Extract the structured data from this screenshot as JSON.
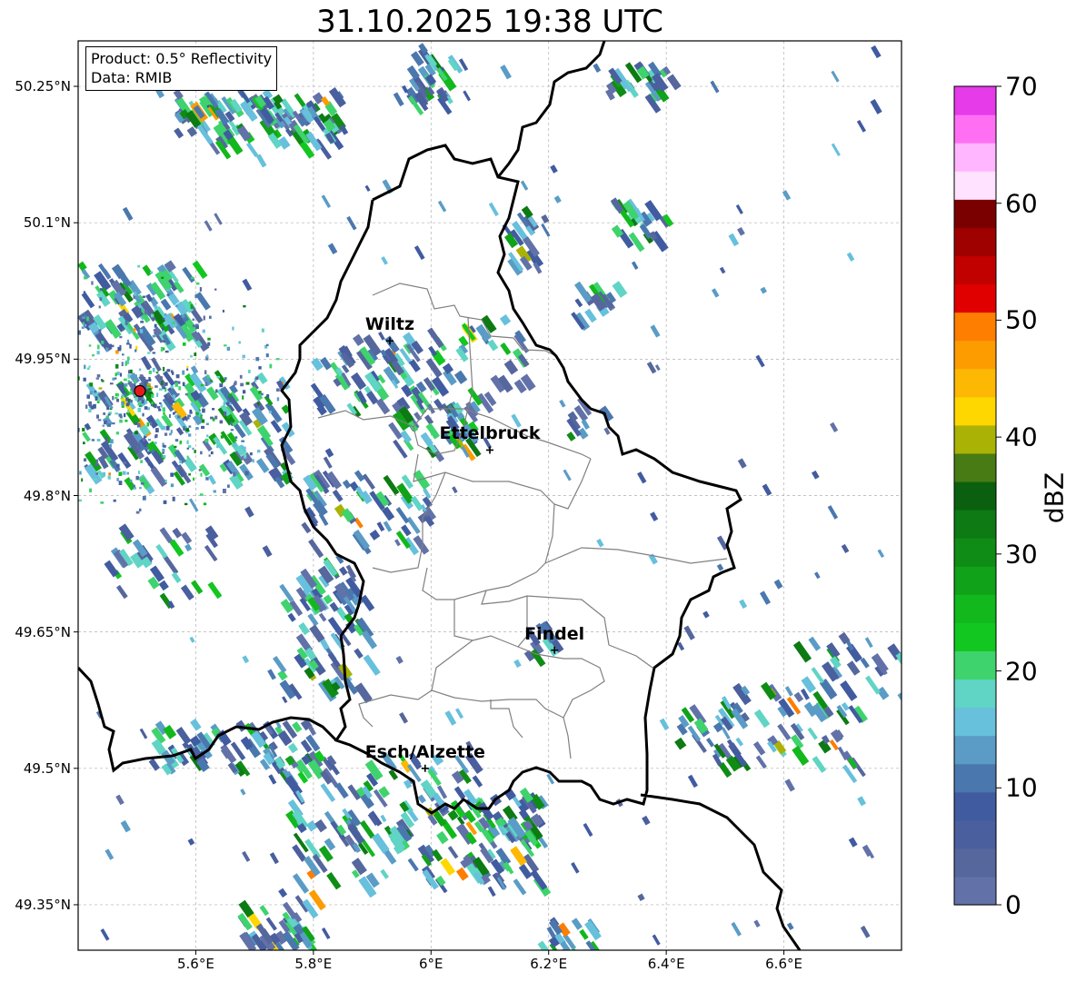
{
  "title": "31.10.2025 19:38 UTC",
  "info": {
    "product": "Product: 0.5° Reflectivity",
    "data_source": "Data: RMIB"
  },
  "map": {
    "extent": {
      "lon": [
        5.4,
        6.8
      ],
      "lat": [
        49.3,
        50.3
      ]
    },
    "lat_ticks": [
      {
        "value": 50.25,
        "label": "50.25°N"
      },
      {
        "value": 50.1,
        "label": "50.1°N"
      },
      {
        "value": 49.95,
        "label": "49.95°N"
      },
      {
        "value": 49.8,
        "label": "49.8°N"
      },
      {
        "value": 49.65,
        "label": "49.65°N"
      },
      {
        "value": 49.5,
        "label": "49.5°N"
      },
      {
        "value": 49.35,
        "label": "49.35°N"
      }
    ],
    "lon_ticks": [
      {
        "value": 5.6,
        "label": "5.6°E"
      },
      {
        "value": 5.8,
        "label": "5.8°E"
      },
      {
        "value": 6.0,
        "label": "6°E"
      },
      {
        "value": 6.2,
        "label": "6.2°E"
      },
      {
        "value": 6.4,
        "label": "6.4°E"
      },
      {
        "value": 6.6,
        "label": "6.6°E"
      }
    ],
    "cities": [
      {
        "name": "Wiltz",
        "lon": 5.93,
        "lat": 49.97
      },
      {
        "name": "Ettelbruck",
        "lon": 6.1,
        "lat": 49.85
      },
      {
        "name": "Findel",
        "lon": 6.21,
        "lat": 49.63
      },
      {
        "name": "Esch/Alzette",
        "lon": 5.99,
        "lat": 49.5
      }
    ],
    "radar_site": {
      "lon": 5.505,
      "lat": 49.915,
      "color": "#e41a1c"
    },
    "border_color": "#000000",
    "canton_color": "#808080",
    "grid": true
  },
  "colorbar": {
    "label": "dBZ",
    "min": 0,
    "max": 70,
    "ticks": [
      "0",
      "10",
      "20",
      "30",
      "40",
      "50",
      "60",
      "70"
    ],
    "colors": [
      "#6272a8",
      "#55679d",
      "#4a5f9e",
      "#415ba0",
      "#4a78ae",
      "#5a9cc6",
      "#67c0dc",
      "#60d4c5",
      "#3ed36c",
      "#12c720",
      "#12b81c",
      "#10a219",
      "#0f8c16",
      "#0d7a13",
      "#0b6010",
      "#487b14",
      "#a9b205",
      "#ffd700",
      "#fdb803",
      "#fc9c01",
      "#fd7e00",
      "#e00000",
      "#c10000",
      "#9f0000",
      "#7a0000",
      "#ffe2ff",
      "#ffb6ff",
      "#ff6ff3",
      "#e53be9"
    ]
  }
}
